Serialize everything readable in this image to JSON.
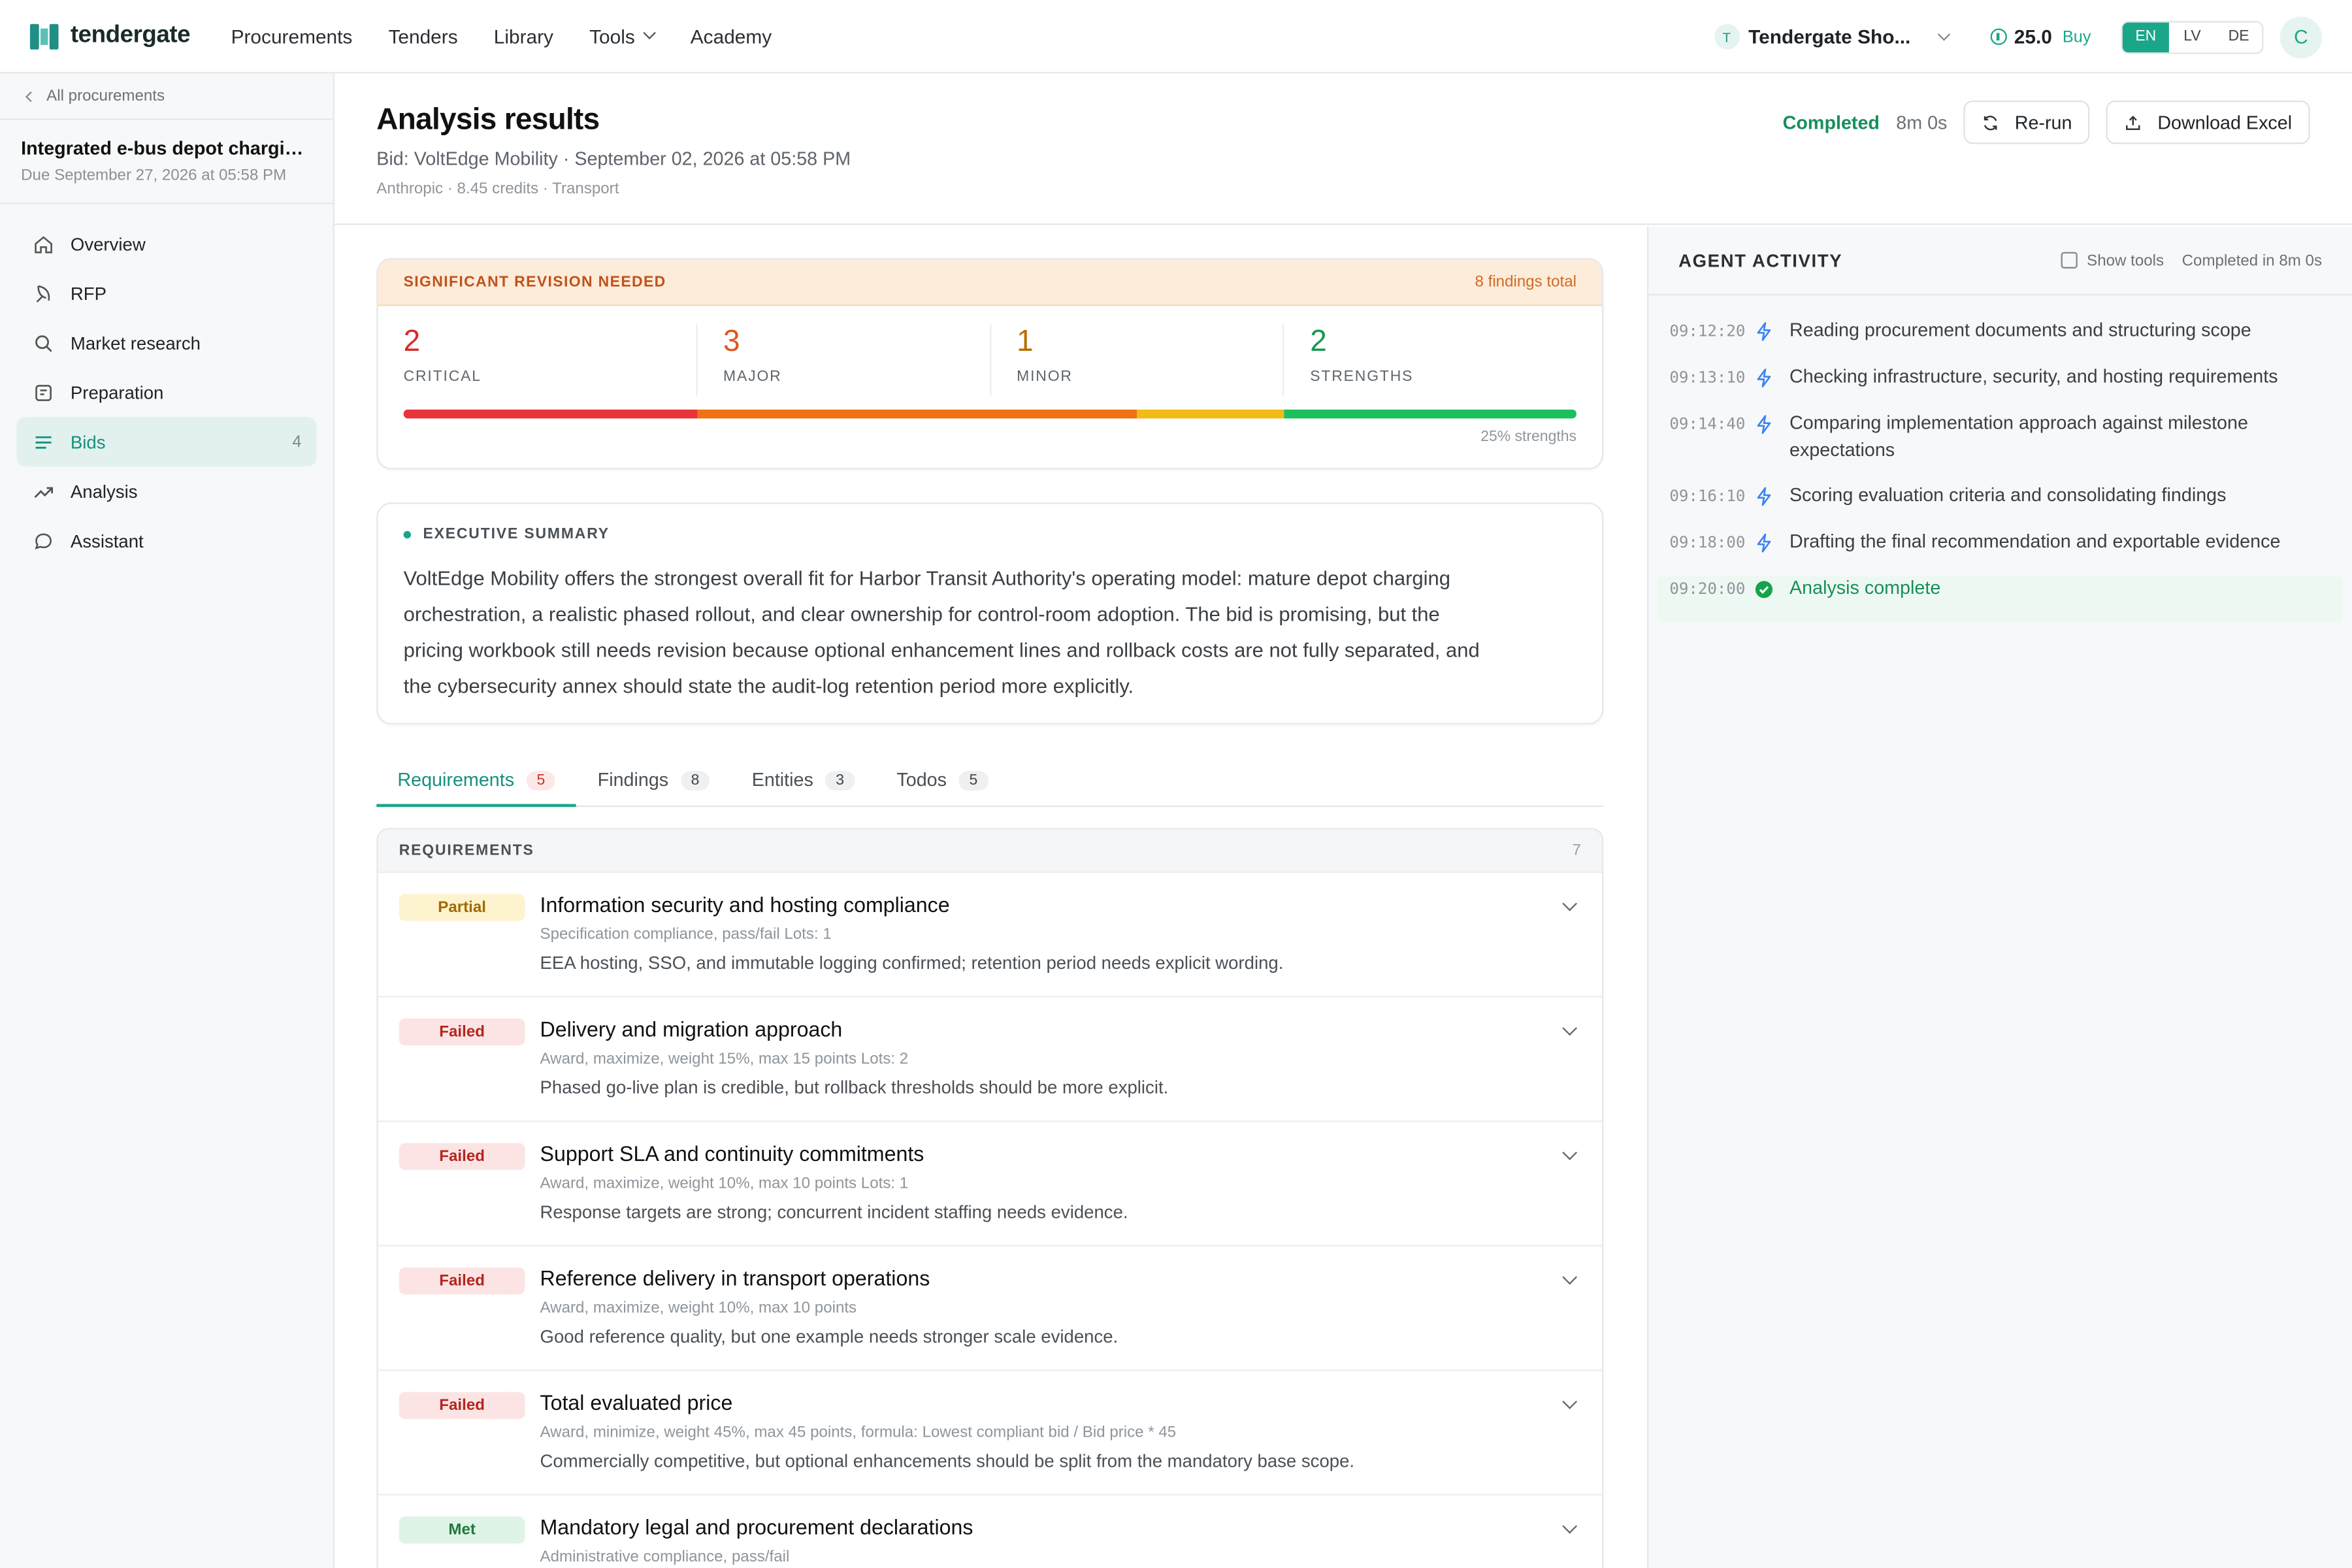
{
  "brand": {
    "name": "tendergate"
  },
  "nav": {
    "links": [
      "Procurements",
      "Tenders",
      "Library",
      "Tools",
      "Academy"
    ],
    "org_initial": "T",
    "org_name": "Tendergate Sho...",
    "credits": "25.0",
    "buy_label": "Buy",
    "languages": [
      "EN",
      "LV",
      "DE"
    ],
    "active_language": "EN",
    "avatar_initial": "C"
  },
  "sidebar": {
    "back_label": "All procurements",
    "project_title": "Integrated e-bus depot charging and energy management",
    "project_due": "Due September 27, 2026 at 05:58 PM",
    "items": [
      {
        "label": "Overview",
        "icon": "home-icon"
      },
      {
        "label": "RFP",
        "icon": "feather-icon"
      },
      {
        "label": "Market research",
        "icon": "search-icon"
      },
      {
        "label": "Preparation",
        "icon": "clipboard-icon"
      },
      {
        "label": "Bids",
        "icon": "list-icon",
        "count": "4",
        "active": true
      },
      {
        "label": "Analysis",
        "icon": "trend-icon"
      },
      {
        "label": "Assistant",
        "icon": "chat-icon"
      }
    ]
  },
  "header": {
    "title": "Analysis results",
    "subtitle": "Bid: VoltEdge Mobility · September 02, 2026 at 05:58 PM",
    "meta": "Anthropic  ·  8.45 credits  ·  Transport",
    "status": "Completed",
    "duration": "8m 0s",
    "rerun_label": "Re-run",
    "download_label": "Download Excel"
  },
  "severity": {
    "label": "SIGNIFICANT REVISION NEEDED",
    "total": "8 findings total",
    "stats": [
      {
        "num": "2",
        "label": "CRITICAL",
        "color": "#d62b2b"
      },
      {
        "num": "3",
        "label": "MAJOR",
        "color": "#e0561a"
      },
      {
        "num": "1",
        "label": "MINOR",
        "color": "#b86e00"
      },
      {
        "num": "2",
        "label": "STRENGTHS",
        "color": "#17994f"
      }
    ],
    "bar": [
      {
        "fraction": 0.25,
        "color": "#e8333a"
      },
      {
        "fraction": 0.375,
        "color": "#f07014"
      },
      {
        "fraction": 0.125,
        "color": "#f2bb16"
      },
      {
        "fraction": 0.25,
        "color": "#1cc05a"
      }
    ],
    "strengths_pct": "25% strengths"
  },
  "summary": {
    "heading": "EXECUTIVE SUMMARY",
    "text": "VoltEdge Mobility offers the strongest overall fit for Harbor Transit Authority's operating model: mature depot charging orchestration, a realistic phased rollout, and clear ownership for control-room adoption. The bid is promising, but the pricing workbook still needs revision because optional enhancement lines and rollback costs are not fully separated, and the cybersecurity annex should state the audit-log retention period more explicitly."
  },
  "tabs": [
    {
      "label": "Requirements",
      "count": "5",
      "active": true
    },
    {
      "label": "Findings",
      "count": "8"
    },
    {
      "label": "Entities",
      "count": "3"
    },
    {
      "label": "Todos",
      "count": "5"
    }
  ],
  "requirements": {
    "heading": "REQUIREMENTS",
    "count": "7",
    "items": [
      {
        "status": "Partial",
        "kind": "partial",
        "title": "Information security and hosting compliance",
        "meta": "Specification compliance, pass/fail   Lots: 1",
        "desc": "EEA hosting, SSO, and immutable logging confirmed; retention period needs explicit wording."
      },
      {
        "status": "Failed",
        "kind": "failed",
        "title": "Delivery and migration approach",
        "meta": "Award, maximize, weight 15%, max 15 points   Lots: 2",
        "desc": "Phased go-live plan is credible, but rollback thresholds should be more explicit."
      },
      {
        "status": "Failed",
        "kind": "failed",
        "title": "Support SLA and continuity commitments",
        "meta": "Award, maximize, weight 10%, max 10 points   Lots: 1",
        "desc": "Response targets are strong; concurrent incident staffing needs evidence."
      },
      {
        "status": "Failed",
        "kind": "failed",
        "title": "Reference delivery in transport operations",
        "meta": "Award, maximize, weight 10%, max 10 points",
        "desc": "Good reference quality, but one example needs stronger scale evidence."
      },
      {
        "status": "Failed",
        "kind": "failed",
        "title": "Total evaluated price",
        "meta": "Award, minimize, weight 45%, max 45 points, formula: Lowest compliant bid / Bid price * 45",
        "desc": "Commercially competitive, but optional enhancements should be split from the mandatory base scope."
      },
      {
        "status": "Met",
        "kind": "met",
        "title": "Mandatory legal and procurement declarations",
        "meta": "Administrative compliance, pass/fail",
        "desc": ""
      }
    ]
  },
  "activity": {
    "title": "AGENT ACTIVITY",
    "show_tools": "Show tools",
    "completed_in": "Completed in 8m 0s",
    "events": [
      {
        "time": "09:12:20",
        "text": "Reading procurement documents and structuring scope",
        "icon": "bolt-icon"
      },
      {
        "time": "09:13:10",
        "text": "Checking infrastructure, security, and hosting requirements",
        "icon": "bolt-icon"
      },
      {
        "time": "09:14:40",
        "text": "Comparing implementation approach against milestone expectations",
        "icon": "bolt-icon"
      },
      {
        "time": "09:16:10",
        "text": "Scoring evaluation criteria and consolidating findings",
        "icon": "bolt-icon"
      },
      {
        "time": "09:18:00",
        "text": "Drafting the final recommendation and exportable evidence",
        "icon": "bolt-icon"
      },
      {
        "time": "09:20:00",
        "text": "Analysis complete",
        "icon": "check-circle-icon",
        "done": true
      }
    ]
  }
}
